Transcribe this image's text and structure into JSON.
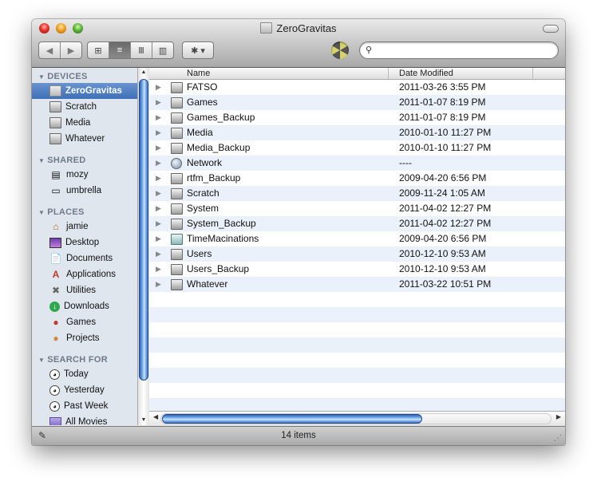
{
  "window": {
    "title": "ZeroGravitas"
  },
  "toolbar": {
    "back_glyph": "◀",
    "forward_glyph": "▶",
    "views": [
      {
        "name": "icon-view",
        "glyph": "⊞",
        "selected": false
      },
      {
        "name": "list-view",
        "glyph": "≡",
        "selected": true
      },
      {
        "name": "column-view",
        "glyph": "Ⅲ",
        "selected": false
      },
      {
        "name": "cover-flow-view",
        "glyph": "▥",
        "selected": false
      }
    ],
    "action_glyph": "✱ ▾",
    "search": {
      "value": "",
      "placeholder": "",
      "icon": "magnifier-icon"
    }
  },
  "sidebar": {
    "sections": [
      {
        "heading": "DEVICES",
        "items": [
          {
            "label": "ZeroGravitas",
            "icon": "mac-icon",
            "selected": true
          },
          {
            "label": "Scratch",
            "icon": "disk-icon"
          },
          {
            "label": "Media",
            "icon": "disk-icon"
          },
          {
            "label": "Whatever",
            "icon": "disk-icon"
          }
        ]
      },
      {
        "heading": "SHARED",
        "items": [
          {
            "label": "mozy",
            "icon": "server-icon"
          },
          {
            "label": "umbrella",
            "icon": "display-icon"
          }
        ]
      },
      {
        "heading": "PLACES",
        "items": [
          {
            "label": "jamie",
            "icon": "home-icon"
          },
          {
            "label": "Desktop",
            "icon": "desktop-icon"
          },
          {
            "label": "Documents",
            "icon": "documents-icon"
          },
          {
            "label": "Applications",
            "icon": "applications-icon"
          },
          {
            "label": "Utilities",
            "icon": "utilities-icon"
          },
          {
            "label": "Downloads",
            "icon": "downloads-icon"
          },
          {
            "label": "Games",
            "icon": "games-icon"
          },
          {
            "label": "Projects",
            "icon": "projects-icon"
          }
        ]
      },
      {
        "heading": "SEARCH FOR",
        "items": [
          {
            "label": "Today",
            "icon": "clock-icon"
          },
          {
            "label": "Yesterday",
            "icon": "clock-icon"
          },
          {
            "label": "Past Week",
            "icon": "clock-icon"
          },
          {
            "label": "All Movies",
            "icon": "folder-icon"
          }
        ]
      }
    ]
  },
  "list": {
    "columns": [
      "Name",
      "Date Modified"
    ],
    "rows": [
      {
        "name": "FATSO",
        "date": "2011-03-26 3:55 PM",
        "icon": "disk"
      },
      {
        "name": "Games",
        "date": "2011-01-07 8:19 PM",
        "icon": "disk"
      },
      {
        "name": "Games_Backup",
        "date": "2011-01-07 8:19 PM",
        "icon": "disk"
      },
      {
        "name": "Media",
        "date": "2010-01-10 11:27 PM",
        "icon": "disk"
      },
      {
        "name": "Media_Backup",
        "date": "2010-01-10 11:27 PM",
        "icon": "disk"
      },
      {
        "name": "Network",
        "date": "----",
        "icon": "globe"
      },
      {
        "name": "rtfm_Backup",
        "date": "2009-04-20 6:56 PM",
        "icon": "disk"
      },
      {
        "name": "Scratch",
        "date": "2009-11-24 1:05 AM",
        "icon": "disk"
      },
      {
        "name": "System",
        "date": "2011-04-02 12:27 PM",
        "icon": "disk"
      },
      {
        "name": "System_Backup",
        "date": "2011-04-02 12:27 PM",
        "icon": "disk"
      },
      {
        "name": "TimeMacinations",
        "date": "2009-04-20 6:56 PM",
        "icon": "tm"
      },
      {
        "name": "Users",
        "date": "2010-12-10 9:53 AM",
        "icon": "disk"
      },
      {
        "name": "Users_Backup",
        "date": "2010-12-10 9:53 AM",
        "icon": "disk"
      },
      {
        "name": "Whatever",
        "date": "2011-03-22 10:51 PM",
        "icon": "disk"
      }
    ]
  },
  "statusbar": {
    "text": "14 items"
  }
}
